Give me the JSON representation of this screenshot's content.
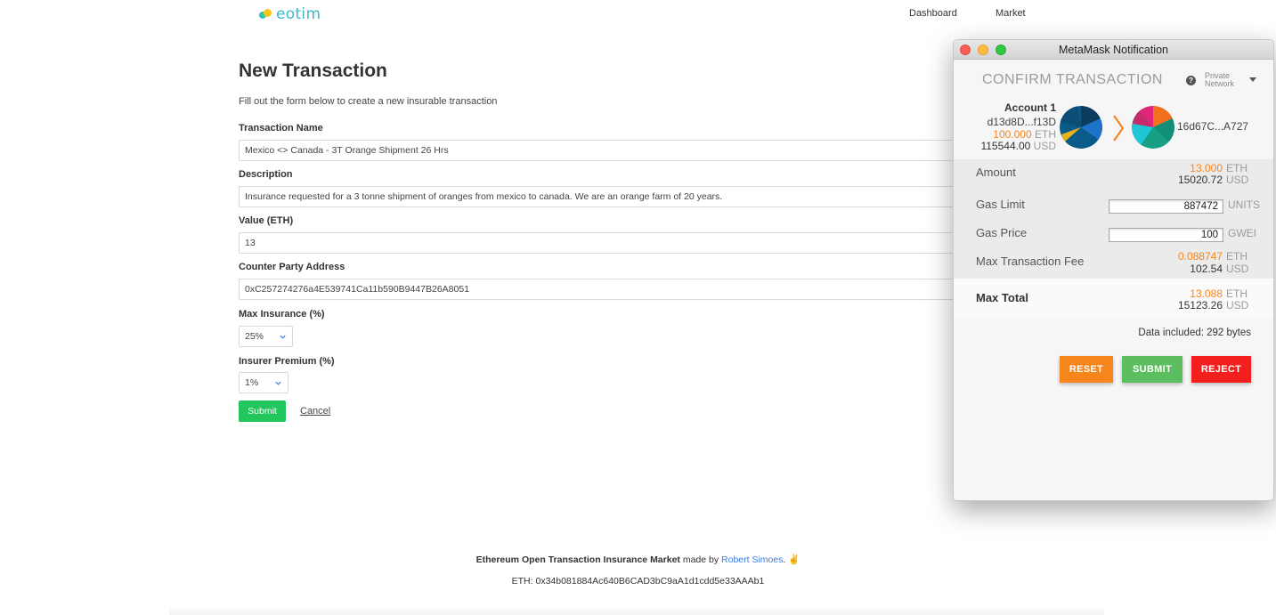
{
  "header": {
    "logo_text": "eotim",
    "nav": [
      {
        "label": "Dashboard"
      },
      {
        "label": "Market"
      }
    ]
  },
  "form": {
    "title": "New Transaction",
    "subtitle": "Fill out the form below to create a new insurable transaction",
    "fields": {
      "name": {
        "label": "Transaction Name",
        "value": "Mexico <> Canada - 3T Orange Shipment 26 Hrs"
      },
      "description": {
        "label": "Description",
        "value": "Insurance requested for a 3 tonne shipment of oranges from mexico to canada. We are an orange farm of 20 years."
      },
      "value": {
        "label": "Value (ETH)",
        "value": "13"
      },
      "counterparty": {
        "label": "Counter Party Address",
        "value": "0xC257274276a4E539741Ca11b590B9447B26A8051"
      },
      "max_insurance": {
        "label": "Max Insurance (%)",
        "value": "25%"
      },
      "insurer_premium": {
        "label": "Insurer Premium (%)",
        "value": "1%"
      }
    },
    "submit_label": "Submit",
    "cancel_label": "Cancel"
  },
  "footer": {
    "app_name": "Ethereum Open Transaction Insurance Market",
    "made_by": " made by ",
    "author": "Robert Simoes",
    "after_author": ". ",
    "emoji": "✌",
    "eth_address": "ETH: 0x34b081884Ac640B6CAD3bC9aA1d1cdd5e33AAAb1"
  },
  "metamask": {
    "window_title": "MetaMask Notification",
    "confirm_title": "CONFIRM TRANSACTION",
    "help_icon": "?",
    "network": [
      "Private",
      "Network"
    ],
    "from": {
      "name": "Account 1",
      "address": "d13d8D...f13D",
      "eth_balance": "100.000",
      "eth_unit": "ETH",
      "usd_balance": "115544.00",
      "usd_unit": "USD"
    },
    "to": {
      "address": "16d67C...A727"
    },
    "amount": {
      "label": "Amount",
      "eth": "13.000",
      "eth_unit": "ETH",
      "usd": "15020.72",
      "usd_unit": "USD"
    },
    "gas_limit": {
      "label": "Gas Limit",
      "value": "887472",
      "unit": "UNITS"
    },
    "gas_price": {
      "label": "Gas Price",
      "value": "100",
      "unit": "GWEI"
    },
    "max_fee": {
      "label": "Max Transaction Fee",
      "eth": "0.088747",
      "eth_unit": "ETH",
      "usd": "102.54",
      "usd_unit": "USD"
    },
    "max_total": {
      "label": "Max Total",
      "eth": "13.088",
      "eth_unit": "ETH",
      "usd": "15123.26",
      "usd_unit": "USD"
    },
    "data_included": "Data included: 292 bytes",
    "buttons": {
      "reset": "RESET",
      "submit": "SUBMIT",
      "reject": "REJECT"
    }
  },
  "colors": {
    "accent_orange": "#f6851b",
    "submit_green": "#21c65c",
    "mm_reset": "#f6851b",
    "mm_submit": "#5cbe5f",
    "mm_reject": "#f31f1f",
    "link_blue": "#3b7ddd"
  }
}
